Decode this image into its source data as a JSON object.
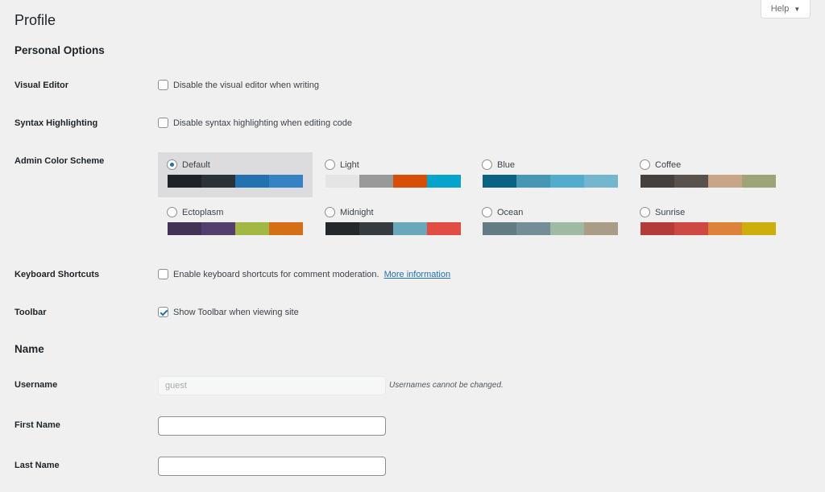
{
  "header": {
    "title": "Profile",
    "help_label": "Help",
    "help_arrow": "▼"
  },
  "personal_options": {
    "heading": "Personal Options",
    "visual_editor": {
      "label": "Visual Editor",
      "option_text": "Disable the visual editor when writing",
      "checked": false
    },
    "syntax_highlighting": {
      "label": "Syntax Highlighting",
      "option_text": "Disable syntax highlighting when editing code",
      "checked": false
    },
    "admin_color_scheme": {
      "label": "Admin Color Scheme",
      "selected": "Default",
      "schemes": [
        {
          "name": "Default",
          "colors": [
            "#1d2327",
            "#2c3338",
            "#2271b1",
            "#3582c4"
          ]
        },
        {
          "name": "Light",
          "colors": [
            "#e5e5e5",
            "#999999",
            "#d64e07",
            "#04a4cc"
          ]
        },
        {
          "name": "Blue",
          "colors": [
            "#096484",
            "#4796b3",
            "#52accc",
            "#74b6ce"
          ]
        },
        {
          "name": "Coffee",
          "colors": [
            "#46403c",
            "#59524c",
            "#c7a589",
            "#9ea476"
          ]
        },
        {
          "name": "Ectoplasm",
          "colors": [
            "#413256",
            "#523f6d",
            "#a3b745",
            "#d46f15"
          ]
        },
        {
          "name": "Midnight",
          "colors": [
            "#25282b",
            "#363b3f",
            "#69a8bb",
            "#e14d43"
          ]
        },
        {
          "name": "Ocean",
          "colors": [
            "#627c83",
            "#738e96",
            "#9ebaa0",
            "#aa9d88"
          ]
        },
        {
          "name": "Sunrise",
          "colors": [
            "#b43c38",
            "#cf4944",
            "#dd823b",
            "#ccaf0b"
          ]
        }
      ]
    },
    "keyboard_shortcuts": {
      "label": "Keyboard Shortcuts",
      "option_text": "Enable keyboard shortcuts for comment moderation.",
      "link_text": "More information",
      "checked": false
    },
    "toolbar": {
      "label": "Toolbar",
      "option_text": "Show Toolbar when viewing site",
      "checked": true
    }
  },
  "name_section": {
    "heading": "Name",
    "username": {
      "label": "Username",
      "value": "guest",
      "description": "Usernames cannot be changed."
    },
    "first_name": {
      "label": "First Name",
      "value": ""
    },
    "last_name": {
      "label": "Last Name",
      "value": ""
    }
  }
}
